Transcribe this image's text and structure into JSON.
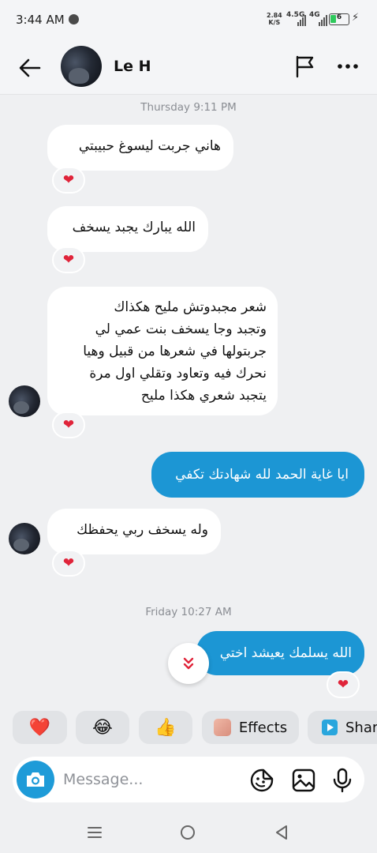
{
  "status_bar": {
    "time": "3:44 AM",
    "network_speed": "2.84",
    "network_speed_unit": "K/S",
    "network_type_1": "4.5G",
    "network_type_2": "4G",
    "battery_level": "6"
  },
  "header": {
    "contact_name": "Le H",
    "icons": [
      "back-arrow-icon",
      "flag-icon",
      "more-icon"
    ]
  },
  "messages": {
    "ts1": "Thursday 9:11 PM",
    "m1": "هاني جربت ليسوغ حبيبتي",
    "m2": "الله يبارك يجبد يسخف",
    "m3": "شعر مجبدوتش مليح هكذاك\nوتجبد وجا يسخف بنت عمي لي\nجربتولها في شعرها من قبيل وهيا\nنحرك فيه وتعاود وتقلي اول مرة\nيتجبد شعري هكذا مليح",
    "m4": "ايا غاية الحمد لله شهادتك تكفي",
    "m5": "وله يسخف ربي يحفظك",
    "ts2": "Friday 10:27 AM",
    "m6": "الله يسلمك يعيشد اختي",
    "reaction": "❤"
  },
  "quick_replies": {
    "heart": "❤️",
    "laugh": "😂",
    "thumbs": "👍",
    "effects": "Effects",
    "share": "Share"
  },
  "composer": {
    "placeholder": "Message..."
  },
  "colors": {
    "outgoing_bubble": "#1c96d4",
    "incoming_bubble": "#ffffff",
    "background": "#eff0f2",
    "accent": "#1e9bd8"
  }
}
